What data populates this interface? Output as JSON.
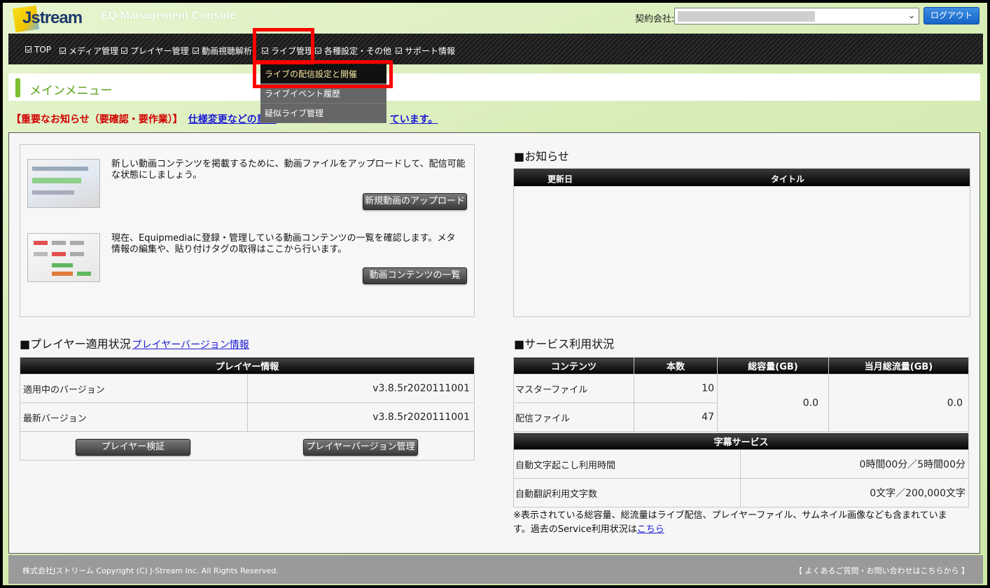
{
  "header": {
    "logo_text": "Jstream",
    "console_title": "EQ Management Console",
    "company_label": "契約会社:",
    "logout_label": "ログアウト"
  },
  "nav": {
    "items": [
      {
        "label": "TOP"
      },
      {
        "label": "メディア管理"
      },
      {
        "label": "プレイヤー管理"
      },
      {
        "label": "動画視聴解析"
      },
      {
        "label": "ライブ管理"
      },
      {
        "label": "各種設定・その他"
      },
      {
        "label": "サポート情報"
      }
    ],
    "dropdown": [
      {
        "label": "ライブの配信設定と開催",
        "active": true
      },
      {
        "label": "ライブイベント履歴"
      },
      {
        "label": "疑似ライブ管理"
      }
    ]
  },
  "main_menu_title": "メインメニュー",
  "notice": {
    "label": "【重要なお知らせ（要確認・要作業）】",
    "link_visible_start": "仕様変更などの重要",
    "link_visible_end": "ています。"
  },
  "media": {
    "upload_desc": "新しい動画コンテンツを掲載するために、動画ファイルをアップロードして、配信可能な状態にしましょう。",
    "upload_button": "新規動画のアップロード",
    "list_desc": "現在、Equipmediaに登録・管理している動画コンテンツの一覧を確認します。メタ情報の編集や、貼り付けタグの取得はここから行います。",
    "list_button": "動画コンテンツの一覧"
  },
  "news": {
    "title": "■お知らせ",
    "col_date": "更新日",
    "col_title": "タイトル"
  },
  "player": {
    "title": "■プレイヤー適用状況",
    "title_link": "プレイヤーバージョン情報",
    "table_header": "プレイヤー情報",
    "rows": [
      {
        "label": "適用中のバージョン",
        "value": "v3.8.5r2020111001"
      },
      {
        "label": "最新バージョン",
        "value": "v3.8.5r2020111001"
      }
    ],
    "verify_button": "プレイヤー検証",
    "version_button": "プレイヤーバージョン管理"
  },
  "service": {
    "title": "■サービス利用状況",
    "headers": [
      "コンテンツ",
      "本数",
      "総容量(GB)",
      "当月総流量(GB)"
    ],
    "rows": [
      {
        "label": "マスターファイル",
        "count": "10"
      },
      {
        "label": "配信ファイル",
        "count": "47"
      }
    ],
    "total_capacity": "0.0",
    "monthly_traffic": "0.0",
    "subtitle_header": "字幕サービス",
    "subtitle_rows": [
      {
        "label": "自動文字起こし利用時間",
        "value": "0時間00分／5時間00分"
      },
      {
        "label": "自動翻訳利用文字数",
        "value": "0文字／200,000文字"
      }
    ],
    "note": "※表示されている総容量、総流量はライブ配信、プレイヤーファイル、サムネイル画像なども含まれています。過去のService利用状況は",
    "note_link": "こちら"
  },
  "footer": {
    "copyright": "株式会社Jストリーム  Copyright (C) J-Stream Inc. All Rights Reserved.",
    "faq": "【 よくあるご質問・お問い合わせはこちらから 】"
  },
  "colors": {
    "accent_green": "#7bbf30",
    "title_green": "#5aa218",
    "highlight_red": "#ff0000",
    "logout_blue": "#1764c6"
  }
}
